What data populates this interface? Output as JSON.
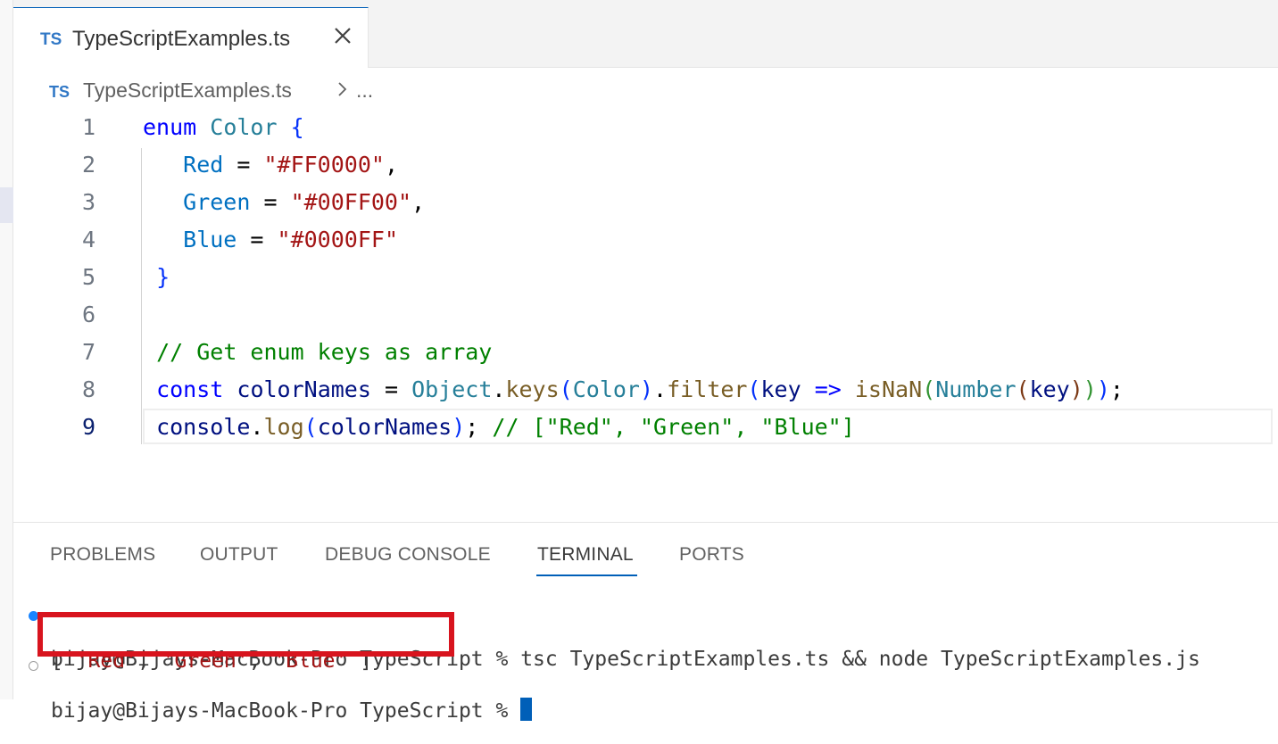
{
  "editor_tab": {
    "lang_badge": "TS",
    "filename": "TypeScriptExamples.ts"
  },
  "breadcrumb": {
    "lang_badge": "TS",
    "file": "TypeScriptExamples.ts",
    "ellipsis": "..."
  },
  "code": {
    "current_line": 9,
    "lines": [
      {
        "num": "1",
        "tokens": [
          [
            "k",
            "enum"
          ],
          [
            "",
            " "
          ],
          [
            "t",
            "Color"
          ],
          [
            "",
            " "
          ],
          [
            "b1",
            "{"
          ]
        ]
      },
      {
        "num": "2",
        "tokens": [
          [
            "",
            "   "
          ],
          [
            "p",
            "Red"
          ],
          [
            "",
            " = "
          ],
          [
            "s",
            "\"#FF0000\""
          ],
          [
            "",
            ","
          ]
        ]
      },
      {
        "num": "3",
        "tokens": [
          [
            "",
            "   "
          ],
          [
            "p",
            "Green"
          ],
          [
            "",
            " = "
          ],
          [
            "s",
            "\"#00FF00\""
          ],
          [
            "",
            ","
          ]
        ]
      },
      {
        "num": "4",
        "tokens": [
          [
            "",
            "   "
          ],
          [
            "p",
            "Blue"
          ],
          [
            "",
            " = "
          ],
          [
            "s",
            "\"#0000FF\""
          ]
        ]
      },
      {
        "num": "5",
        "tokens": [
          [
            "",
            " "
          ],
          [
            "b1",
            "}"
          ]
        ]
      },
      {
        "num": "6",
        "tokens": []
      },
      {
        "num": "7",
        "tokens": [
          [
            "",
            " "
          ],
          [
            "c",
            "// Get enum keys as array"
          ]
        ]
      },
      {
        "num": "8",
        "tokens": [
          [
            "",
            " "
          ],
          [
            "k",
            "const"
          ],
          [
            "",
            " "
          ],
          [
            "v",
            "colorNames"
          ],
          [
            "",
            " = "
          ],
          [
            "t",
            "Object"
          ],
          [
            "",
            "."
          ],
          [
            "f",
            "keys"
          ],
          [
            "b1",
            "("
          ],
          [
            "t",
            "Color"
          ],
          [
            "b1",
            ")"
          ],
          [
            "",
            "."
          ],
          [
            "f",
            "filter"
          ],
          [
            "b1",
            "("
          ],
          [
            "v",
            "key"
          ],
          [
            "",
            " "
          ],
          [
            "k",
            "=>"
          ],
          [
            "",
            " "
          ],
          [
            "f",
            "isNaN"
          ],
          [
            "b2",
            "("
          ],
          [
            "t",
            "Number"
          ],
          [
            "b3",
            "("
          ],
          [
            "v",
            "key"
          ],
          [
            "b3",
            ")"
          ],
          [
            "b2",
            ")"
          ],
          [
            "b1",
            ")"
          ],
          [
            "",
            ";"
          ]
        ]
      },
      {
        "num": "9",
        "tokens": [
          [
            "",
            " "
          ],
          [
            "v",
            "console"
          ],
          [
            "",
            "."
          ],
          [
            "f",
            "log"
          ],
          [
            "b1",
            "("
          ],
          [
            "v",
            "colorNames"
          ],
          [
            "b1",
            ")"
          ],
          [
            "",
            "; "
          ],
          [
            "c",
            "// [\"Red\", \"Green\", \"Blue\"]"
          ]
        ]
      }
    ]
  },
  "panel": {
    "tabs": [
      {
        "label": "PROBLEMS",
        "active": false
      },
      {
        "label": "OUTPUT",
        "active": false
      },
      {
        "label": "DEBUG CONSOLE",
        "active": false
      },
      {
        "label": "TERMINAL",
        "active": true
      },
      {
        "label": "PORTS",
        "active": false
      }
    ]
  },
  "terminal": {
    "line1": "bijay@Bijays-MacBook-Pro TypeScript % tsc TypeScriptExamples.ts && node TypeScriptExamples.js",
    "output": {
      "open": "[ ",
      "v1": "'Red'",
      "sep1": ", ",
      "v2": "'Green'",
      "sep2": ", ",
      "v3": "'Blue'",
      "close": " ]"
    },
    "line3": "bijay@Bijays-MacBook-Pro TypeScript % "
  },
  "colors": {
    "accent": "#005fb8",
    "highlight_box": "#d8141e",
    "ts_badge": "#3178c6"
  }
}
